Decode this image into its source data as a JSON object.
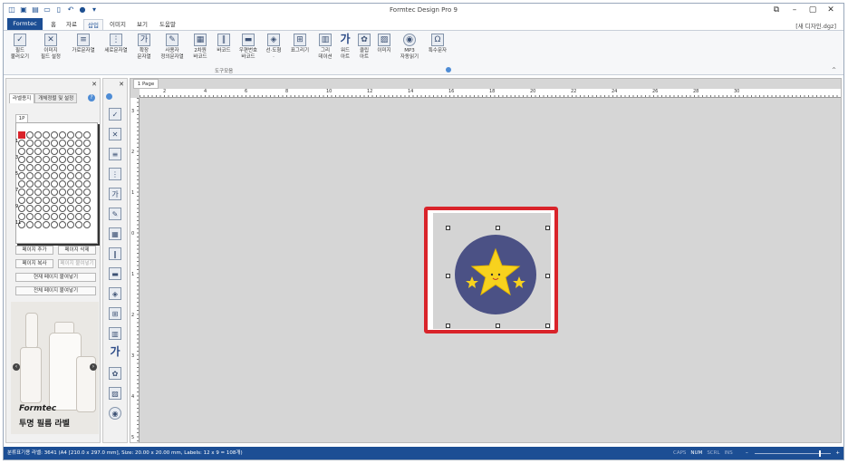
{
  "app_title": "Formtec Design Pro 9",
  "doc_title": "[새 디자인.dgz]",
  "colors": {
    "brand": "#1c4e94",
    "highlight": "#d9232a",
    "circle_fill": "#4b5185",
    "star": "#f7d21e"
  },
  "tabs": [
    "Formtec",
    "홈",
    "자료",
    "삽입",
    "이미지",
    "보기",
    "도움말"
  ],
  "active_tab": "삽입",
  "ribbon": {
    "buttons": [
      "필드\n불러오기",
      "이미지\n필드 설정",
      "가로문자열",
      "세로문자열",
      "확장\n문자열",
      "사용자\n정의문자열",
      "2차원\n바코드",
      "바코드",
      "우편번호\n바코드",
      "선·도형\n·",
      "표그리기",
      "그리\n데이션",
      "워드\n아트",
      "클립\n아트",
      "이미지",
      "MP3\n자동읽기",
      "특수문자"
    ],
    "group_label": "도구모음"
  },
  "left_panel": {
    "tabs": [
      "라벨용지",
      "개체정렬 및 설정"
    ],
    "page_tab": "1P",
    "row_labels": [
      "1",
      "3",
      "5",
      "7",
      "9",
      "11"
    ],
    "buttons": {
      "add_page": "페이지 추가",
      "delete_page": "페이지 삭제",
      "copy_page": "페이지 복사",
      "paste_page": "페이지 붙여넣기",
      "paste_current": "현재 페이지 붙여넣기",
      "paste_all": "전체 페이지 붙여넣기"
    },
    "ad": {
      "logo": "Formtec",
      "text": "투명 필름 라벨"
    }
  },
  "canvas": {
    "page_tab": "1 Page",
    "hruler_numbers": [
      "2",
      "4",
      "6",
      "8",
      "10",
      "12",
      "14",
      "16",
      "18",
      "20",
      "22",
      "24",
      "26",
      "28",
      "30"
    ],
    "vruler_numbers": [
      "3",
      "2",
      "1",
      "0",
      "1",
      "2",
      "3",
      "4",
      "5"
    ]
  },
  "status": {
    "left": "분류표기용 라벨: 3641 (A4 [210.0 x 297.0 mm], Size: 20.00 x 20.00 mm,  Labels: 12 x 9 = 108개)",
    "keys": [
      "CAPS",
      "NUM",
      "SCRL",
      "INS"
    ],
    "active_keys": [
      "NUM"
    ],
    "zoom_level": 0.85
  }
}
